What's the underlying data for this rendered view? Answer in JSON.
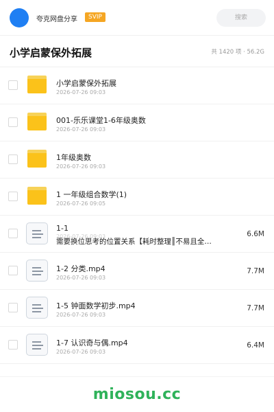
{
  "topbar": {
    "brand": "夸克网盘分享",
    "badge": "SVIP",
    "search_placeholder": "搜索"
  },
  "header": {
    "title": "小学启蒙保外拓展",
    "summary": "共 1420 项 · 56.2G"
  },
  "items": [
    {
      "type": "folder",
      "name": "小学启蒙保外拓展",
      "date": "2026-07-26 09:03",
      "size": ""
    },
    {
      "type": "folder",
      "name": "001-乐乐课堂1-6年级奥数",
      "date": "2026-07-26 09:03",
      "size": ""
    },
    {
      "type": "folder",
      "name": "1年级奥数",
      "date": "2026-07-26 09:03",
      "size": ""
    },
    {
      "type": "folder",
      "name": "1 一年级组合数学(1)",
      "date": "2026-07-26 09:05",
      "size": ""
    },
    {
      "type": "file",
      "name": "1-1",
      "name_line2": "需要换位思考的位置关系【耗时整理║不易且全…",
      "date": "2026-07-26 09:03",
      "size": "6.6M"
    },
    {
      "type": "file",
      "name": "1-2 分类.mp4",
      "date": "2026-07-26 09:03",
      "size": "7.7M"
    },
    {
      "type": "file",
      "name": "1-5 钟面数学初步.mp4",
      "date": "2026-07-26 09:03",
      "size": "7.7M"
    },
    {
      "type": "file",
      "name": "1-7 认识奇与偶.mp4",
      "date": "2026-07-26 09:03",
      "size": "6.4M"
    }
  ],
  "watermark": "miosou.cc",
  "colors": {
    "accent": "#1f7ff3",
    "badge": "#f5a623",
    "folder": "#fbc21a",
    "watermark": "#2fb25a"
  }
}
